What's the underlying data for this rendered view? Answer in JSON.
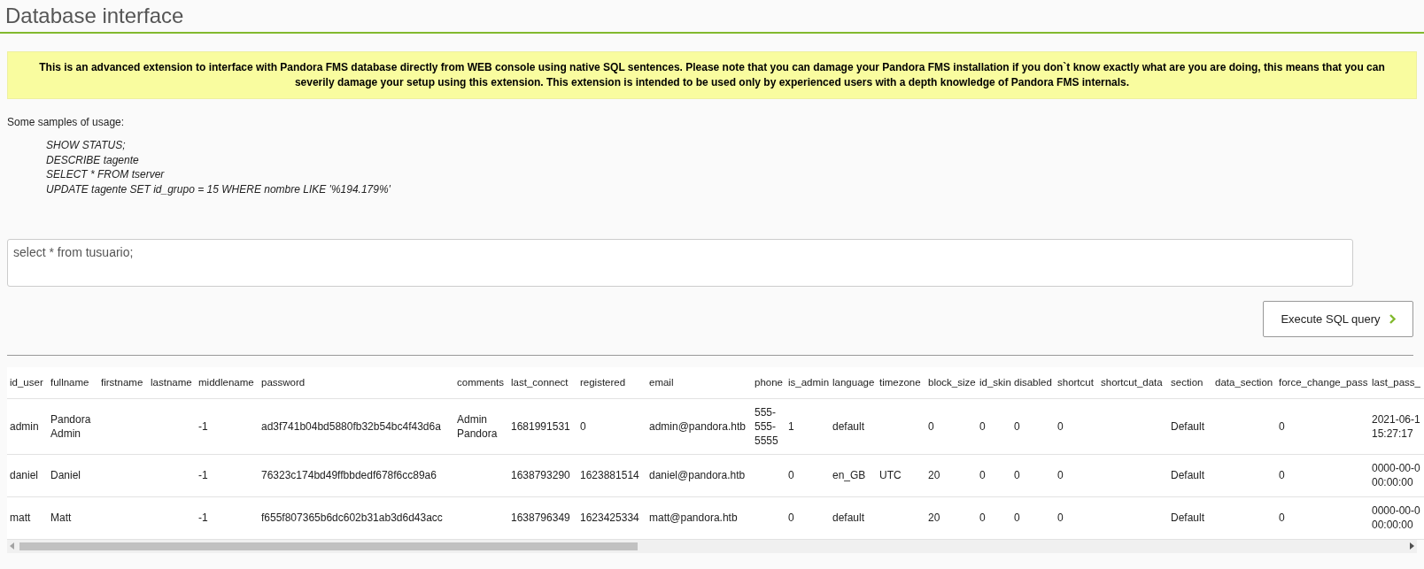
{
  "title": "Database interface",
  "warning": "This is an advanced extension to interface with Pandora FMS database directly from WEB console using native SQL sentences. Please note that you can damage your Pandora FMS installation if you don`t know exactly what are you are doing, this means that you can severily damage your setup using this extension. This extension is intended to be used only by experienced users with a depth knowledge of Pandora FMS internals.",
  "samples_label": "Some samples of usage:",
  "samples": [
    "SHOW STATUS;",
    "DESCRIBE tagente",
    "SELECT * FROM tserver",
    "UPDATE tagente SET id_grupo = 15 WHERE nombre LIKE '%194.179%'"
  ],
  "query": {
    "value": "select * from tusuario;"
  },
  "execute_button": {
    "label": "Execute SQL query"
  },
  "table": {
    "columns": [
      "id_user",
      "fullname",
      "firstname",
      "lastname",
      "middlename",
      "password",
      "comments",
      "last_connect",
      "registered",
      "email",
      "phone",
      "is_admin",
      "language",
      "timezone",
      "block_size",
      "id_skin",
      "disabled",
      "shortcut",
      "shortcut_data",
      "section",
      "data_section",
      "force_change_pass",
      "last_pass_"
    ],
    "rows": [
      [
        "admin",
        "Pandora Admin",
        null,
        null,
        "-1",
        "ad3f741b04bd5880fb32b54bc4f43d6a",
        "Admin Pandora",
        "1681991531",
        "0",
        "admin@pandora.htb",
        "555-555-5555",
        "1",
        "default",
        null,
        "0",
        "0",
        "0",
        "0",
        null,
        "Default",
        null,
        "0",
        "2021-06-1 15:27:17"
      ],
      [
        "daniel",
        "Daniel",
        null,
        null,
        "-1",
        "76323c174bd49ffbbdedf678f6cc89a6",
        null,
        "1638793290",
        "1623881514",
        "daniel@pandora.htb",
        null,
        "0",
        "en_GB",
        "UTC",
        "20",
        "0",
        "0",
        "0",
        null,
        "Default",
        null,
        "0",
        "0000-00-0 00:00:00"
      ],
      [
        "matt",
        "Matt",
        null,
        null,
        "-1",
        "f655f807365b6dc602b31ab3d6d43acc",
        null,
        "1638796349",
        "1623425334",
        "matt@pandora.htb",
        null,
        "0",
        "default",
        null,
        "20",
        "0",
        "0",
        "0",
        null,
        "Default",
        null,
        "0",
        "0000-00-0 00:00:00"
      ]
    ]
  }
}
